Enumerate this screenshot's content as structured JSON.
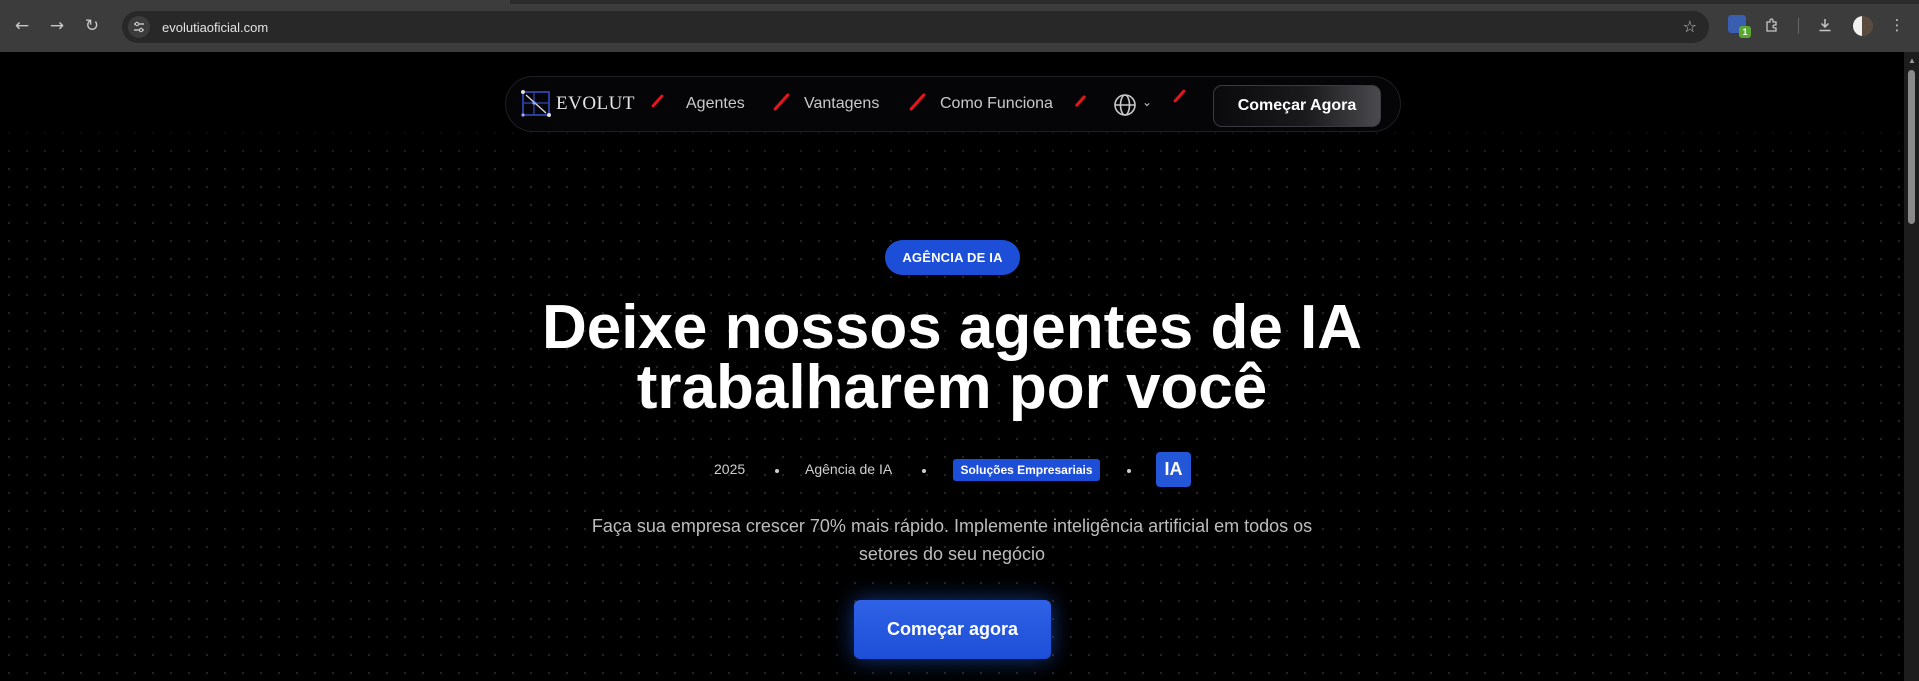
{
  "browser": {
    "url": "evolutiaoficial.com",
    "extension_badge_count": "1"
  },
  "navbar": {
    "logo_text": "EVOLUT",
    "links": [
      "Agentes",
      "Vantagens",
      "Como Funciona"
    ],
    "cta_label": "Começar Agora",
    "accent_color": "#e4151b"
  },
  "hero": {
    "badge": "AGÊNCIA DE IA",
    "headline_line1": "Deixe nossos agentes de IA",
    "headline_line2": "trabalharem por você",
    "meta": {
      "year": "2025",
      "category": "Agência de IA",
      "chip": "Soluções Empresariais",
      "ia_tag": "IA"
    },
    "description_line1": "Faça sua empresa crescer 70% mais rápido. Implemente inteligência artificial em todos os",
    "description_line2": "setores do seu negócio",
    "cta_label": "Começar agora",
    "brand_color": "#1d4ed8"
  }
}
